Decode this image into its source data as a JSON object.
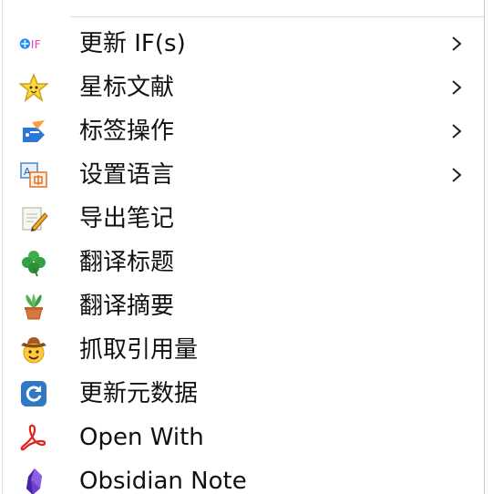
{
  "menu": {
    "items": [
      {
        "label": "更新 IF(s)",
        "icon": "if-icon",
        "icon_text": "IF",
        "has_submenu": true
      },
      {
        "label": "星标文献",
        "icon": "star-icon",
        "has_submenu": true
      },
      {
        "label": "标签操作",
        "icon": "tag-icon",
        "has_submenu": true
      },
      {
        "label": "设置语言",
        "icon": "language-icon",
        "has_submenu": true
      },
      {
        "label": "导出笔记",
        "icon": "notepad-icon",
        "has_submenu": false
      },
      {
        "label": "翻译标题",
        "icon": "clover-icon",
        "has_submenu": false
      },
      {
        "label": "翻译摘要",
        "icon": "potted-plant-icon",
        "has_submenu": false
      },
      {
        "label": "抓取引用量",
        "icon": "cowboy-face-icon",
        "has_submenu": false
      },
      {
        "label": "更新元数据",
        "icon": "refresh-icon",
        "has_submenu": false
      },
      {
        "label": "Open With",
        "icon": "pdf-icon",
        "has_submenu": false
      },
      {
        "label": "Obsidian Note",
        "icon": "obsidian-icon",
        "has_submenu": false
      }
    ]
  },
  "colors": {
    "if_blue": "#1a8cff",
    "if_pink": "#ff3fa6",
    "star_yellow": "#ffd83b",
    "pdf_red": "#e2231a",
    "obsidian_purple": "#6c3fd1",
    "refresh_blue": "#2f78c4"
  }
}
